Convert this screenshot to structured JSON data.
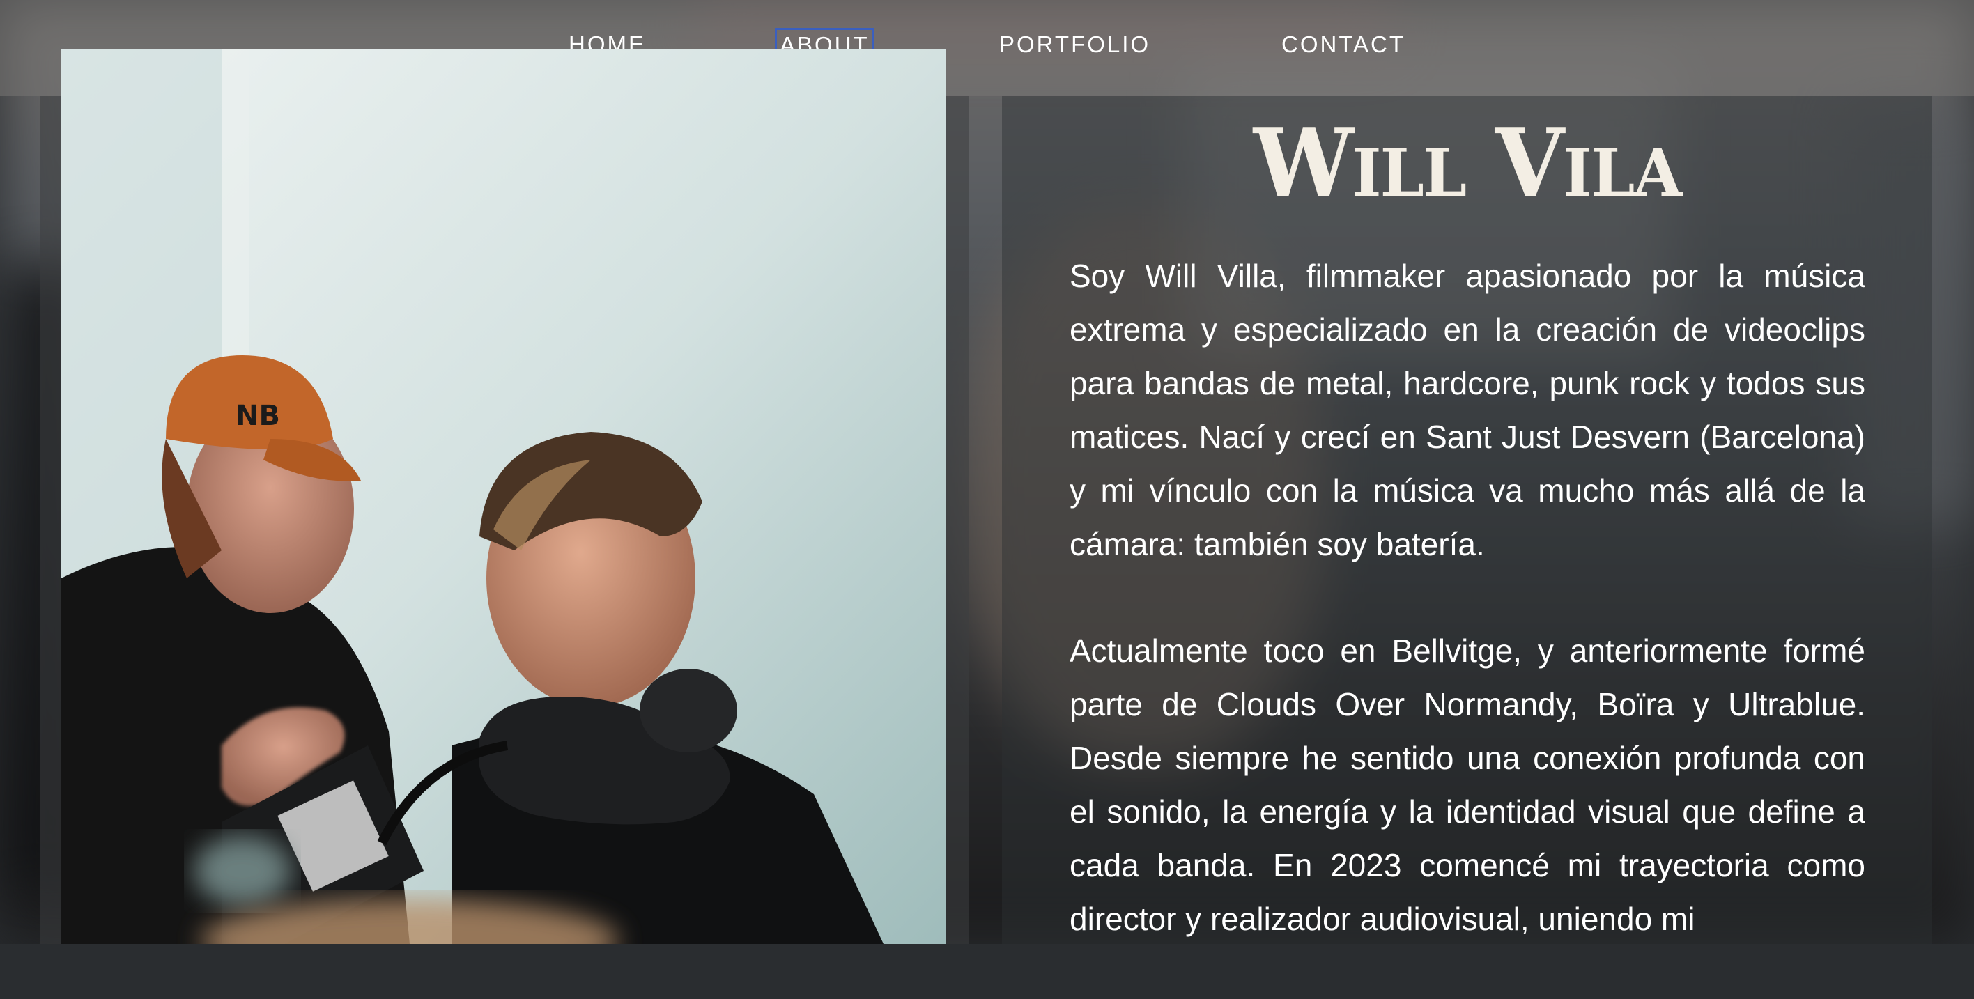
{
  "nav": {
    "items": [
      {
        "label": "HOME"
      },
      {
        "label": "ABOUT",
        "active": true
      },
      {
        "label": "PORTFOLIO"
      },
      {
        "label": "CONTACT"
      }
    ]
  },
  "profile": {
    "name": "Will Vila",
    "bio_paragraphs": [
      "Soy Will Villa, filmmaker apasionado por la música extrema y especializado en la creación de videoclips para bandas de metal, hardcore, punk rock y todos sus matices. Nací y crecí en Sant Just Desvern (Barcelona) y mi vínculo con la música va mucho más allá de la cámara: también soy batería.",
      "Actualmente toco en Bellvitge, y anteriormente formé parte de Clouds Over Normandy, Boïra y Ultrablue. Desde siempre he sentido una conexión profunda con el sonido, la energía y la identidad visual que define a cada banda. En 2023 comencé mi trayectoria como director y realizador audiovisual, uniendo mi"
    ]
  },
  "colors": {
    "accent_focus": "#3a5fbf",
    "active_underline": "#8fd0e0",
    "name_color": "#f3eee4"
  }
}
